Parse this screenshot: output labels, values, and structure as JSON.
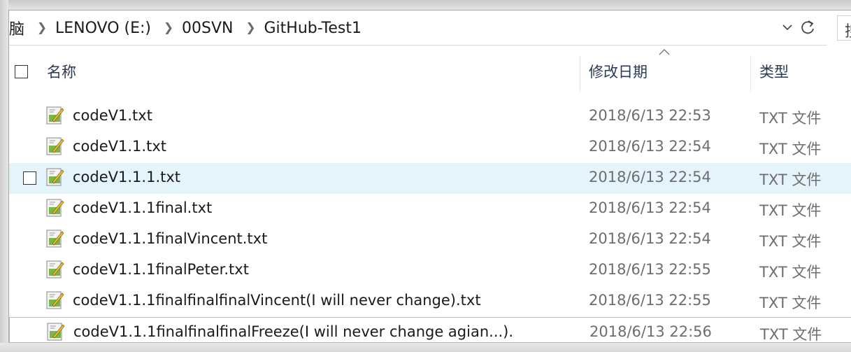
{
  "address_bar": {
    "crumbs": [
      "脑",
      "LENOVO (E:)",
      "00SVN",
      "GitHub-Test1"
    ],
    "search_placeholder": "搜"
  },
  "columns": {
    "name": "名称",
    "date": "修改日期",
    "type": "类型"
  },
  "files": [
    {
      "name": "codeV1.txt",
      "date": "2018/6/13 22:53",
      "type": "TXT 文件"
    },
    {
      "name": "codeV1.1.txt",
      "date": "2018/6/13 22:54",
      "type": "TXT 文件"
    },
    {
      "name": "codeV1.1.1.txt",
      "date": "2018/6/13 22:54",
      "type": "TXT 文件"
    },
    {
      "name": "codeV1.1.1final.txt",
      "date": "2018/6/13 22:54",
      "type": "TXT 文件"
    },
    {
      "name": "codeV1.1.1finalVincent.txt",
      "date": "2018/6/13 22:54",
      "type": "TXT 文件"
    },
    {
      "name": "codeV1.1.1finalPeter.txt",
      "date": "2018/6/13 22:55",
      "type": "TXT 文件"
    },
    {
      "name": "codeV1.1.1finalfinalfinalVincent(I will never change).txt",
      "date": "2018/6/13 22:55",
      "type": "TXT 文件"
    },
    {
      "name": "codeV1.1.1finalfinalfinalFreeze(I will never change agian...).",
      "date": "2018/6/13 22:56",
      "type": "TXT 文件"
    }
  ],
  "icons": {
    "file": "text-file-icon",
    "dropdown": "chevron-down-icon",
    "refresh": "refresh-icon",
    "sort": "sort-ascending-icon"
  }
}
